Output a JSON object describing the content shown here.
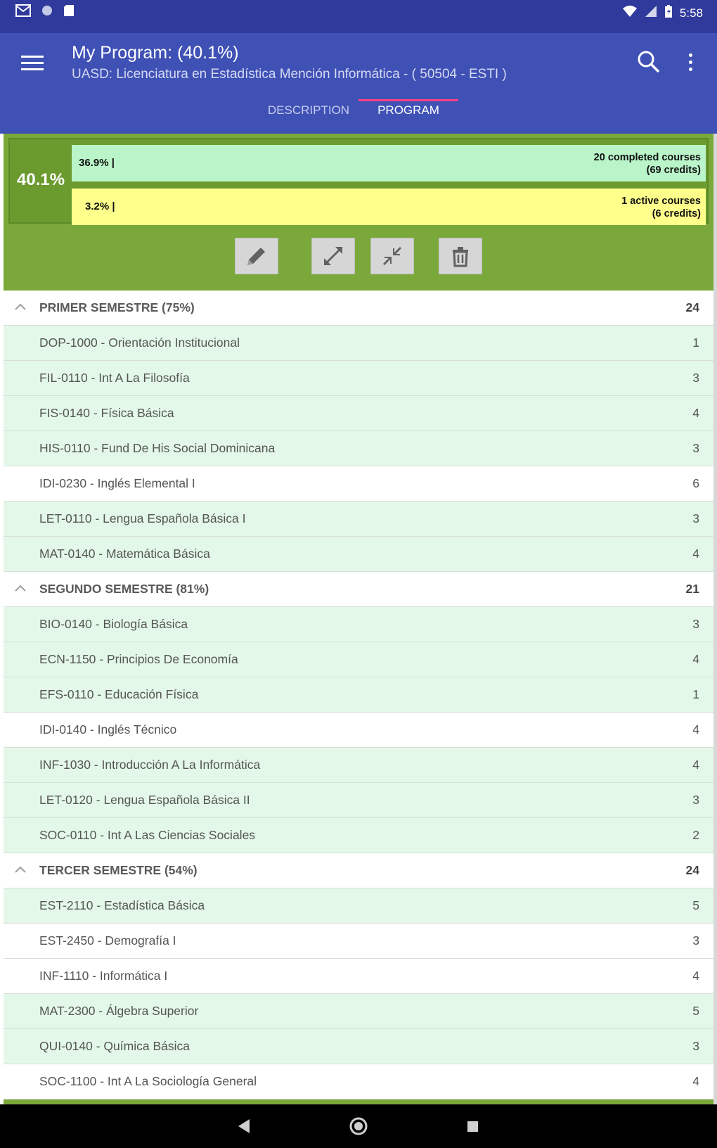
{
  "status_bar": {
    "time": "5:58",
    "icons": [
      "gmail-icon",
      "circle-icon",
      "sd-card-icon",
      "wifi-icon",
      "signal-icon",
      "battery-icon"
    ]
  },
  "app_bar": {
    "title": "My Program: (40.1%)",
    "subtitle": "UASD: Licenciatura en Estadística Mención Informática - ( 50504 - ESTI )",
    "tabs": [
      {
        "label": "DESCRIPTION",
        "selected": false
      },
      {
        "label": "PROGRAM",
        "selected": true
      }
    ],
    "accent_color": "#3f51b5",
    "indicator_color": "#ff4081"
  },
  "summary": {
    "overall": "40.1%",
    "completed": {
      "percent": "36.9% |",
      "line1": "20 completed courses",
      "line2": "(69 credits)"
    },
    "active": {
      "percent": "3.2% |",
      "line1": "1 active courses",
      "line2": "(6 credits)"
    }
  },
  "toolbar": {
    "buttons": [
      "edit-icon",
      "expand-icon",
      "collapse-icon",
      "delete-icon"
    ]
  },
  "semesters": [
    {
      "title": "PRIMER SEMESTRE (75%)",
      "credits": "24",
      "courses": [
        {
          "name": "DOP-1000 - Orientación Institucional",
          "credits": "1",
          "status": "completed"
        },
        {
          "name": "FIL-0110 - Int A La Filosofía",
          "credits": "3",
          "status": "completed"
        },
        {
          "name": "FIS-0140 - Física Básica",
          "credits": "4",
          "status": "completed"
        },
        {
          "name": "HIS-0110 - Fund De His Social Dominicana",
          "credits": "3",
          "status": "completed"
        },
        {
          "name": "IDI-0230 - Inglés Elemental I",
          "credits": "6",
          "status": "pending"
        },
        {
          "name": "LET-0110 - Lengua Española Básica I",
          "credits": "3",
          "status": "completed"
        },
        {
          "name": "MAT-0140 - Matemática Básica",
          "credits": "4",
          "status": "completed"
        }
      ]
    },
    {
      "title": "SEGUNDO SEMESTRE (81%)",
      "credits": "21",
      "courses": [
        {
          "name": "BIO-0140 - Biología Básica",
          "credits": "3",
          "status": "completed"
        },
        {
          "name": "ECN-1150 - Principios De Economía",
          "credits": "4",
          "status": "completed"
        },
        {
          "name": "EFS-0110 - Educación Física",
          "credits": "1",
          "status": "completed"
        },
        {
          "name": "IDI-0140 - Inglés Técnico",
          "credits": "4",
          "status": "pending"
        },
        {
          "name": "INF-1030 - Introducción A La Informática",
          "credits": "4",
          "status": "completed"
        },
        {
          "name": "LET-0120 - Lengua Española Básica II",
          "credits": "3",
          "status": "completed"
        },
        {
          "name": "SOC-0110 - Int A Las Ciencias Sociales",
          "credits": "2",
          "status": "completed"
        }
      ]
    },
    {
      "title": "TERCER SEMESTRE (54%)",
      "credits": "24",
      "courses": [
        {
          "name": "EST-2110 - Estadística Básica",
          "credits": "5",
          "status": "completed"
        },
        {
          "name": "EST-2450 - Demografía I",
          "credits": "3",
          "status": "pending"
        },
        {
          "name": "INF-1110 - Informática I",
          "credits": "4",
          "status": "pending"
        },
        {
          "name": "MAT-2300 - Álgebra Superior",
          "credits": "5",
          "status": "completed"
        },
        {
          "name": "QUI-0140 - Química Básica",
          "credits": "3",
          "status": "completed"
        },
        {
          "name": "SOC-1100 - Int A La Sociología General",
          "credits": "4",
          "status": "pending"
        }
      ]
    }
  ],
  "nav_bar": {
    "buttons": [
      "back-icon",
      "home-icon",
      "recents-icon"
    ]
  }
}
